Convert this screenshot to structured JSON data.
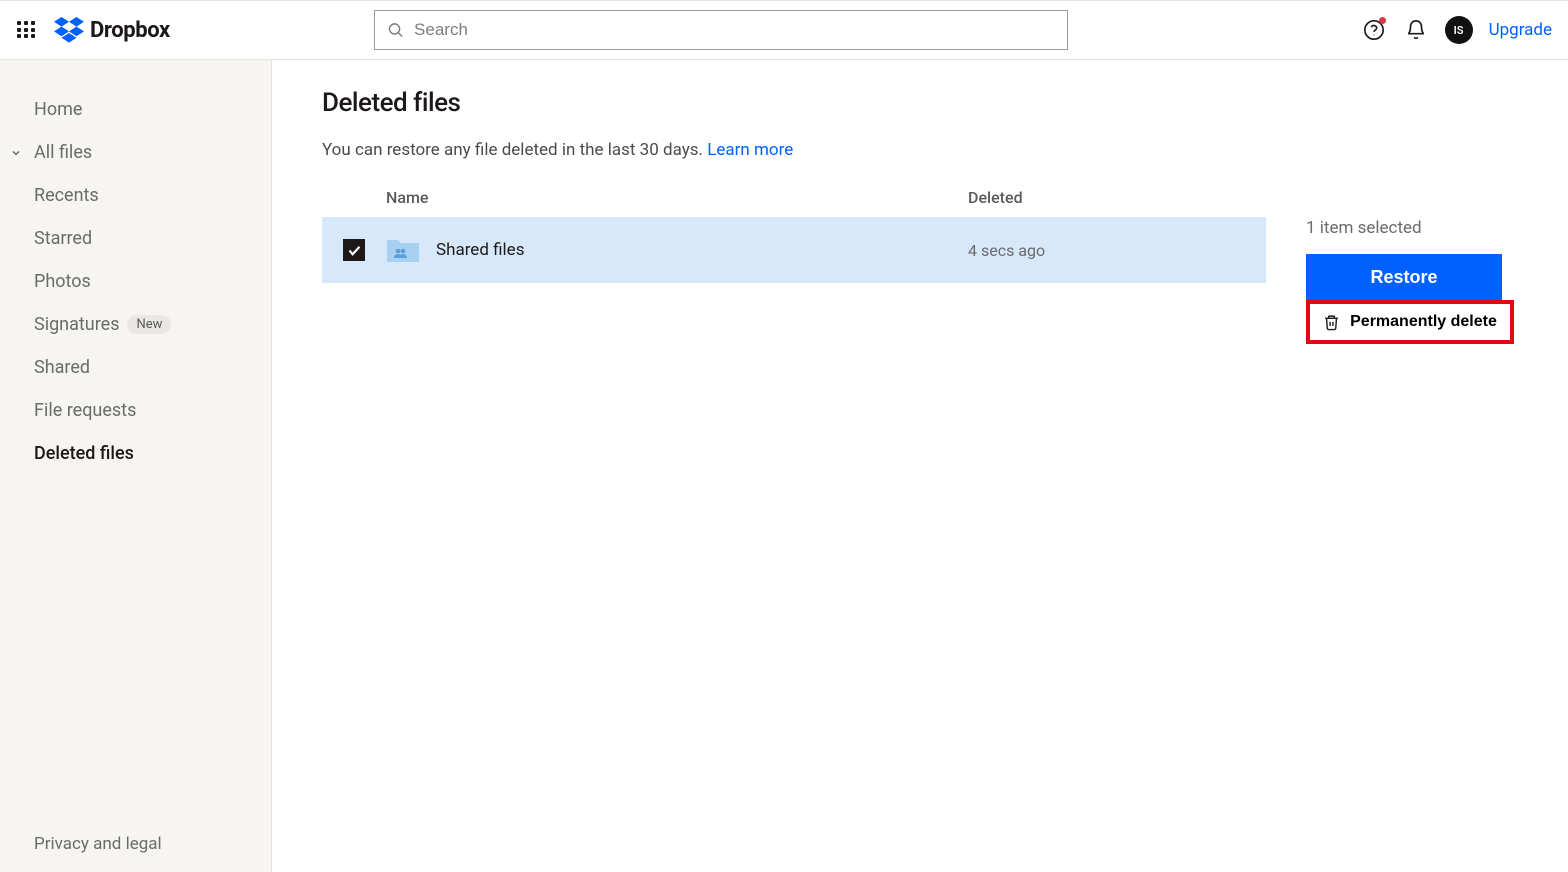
{
  "brand": {
    "name": "Dropbox"
  },
  "search": {
    "placeholder": "Search"
  },
  "header": {
    "upgrade": "Upgrade",
    "avatar_initials": "IS"
  },
  "sidebar": {
    "items": [
      {
        "label": "Home"
      },
      {
        "label": "All files"
      },
      {
        "label": "Recents"
      },
      {
        "label": "Starred"
      },
      {
        "label": "Photos"
      },
      {
        "label": "Signatures",
        "badge": "New"
      },
      {
        "label": "Shared"
      },
      {
        "label": "File requests"
      },
      {
        "label": "Deleted files"
      }
    ],
    "bottom": "Privacy and legal"
  },
  "main": {
    "title": "Deleted files",
    "subtitle_text": "You can restore any file deleted in the last 30 days. ",
    "learn_more": "Learn more",
    "columns": {
      "name": "Name",
      "deleted": "Deleted"
    },
    "rows": [
      {
        "name": "Shared files",
        "deleted": "4 secs ago",
        "checked": true
      }
    ]
  },
  "panel": {
    "selected_text": "1 item selected",
    "restore_label": "Restore",
    "perm_delete_label": "Permanently delete"
  }
}
